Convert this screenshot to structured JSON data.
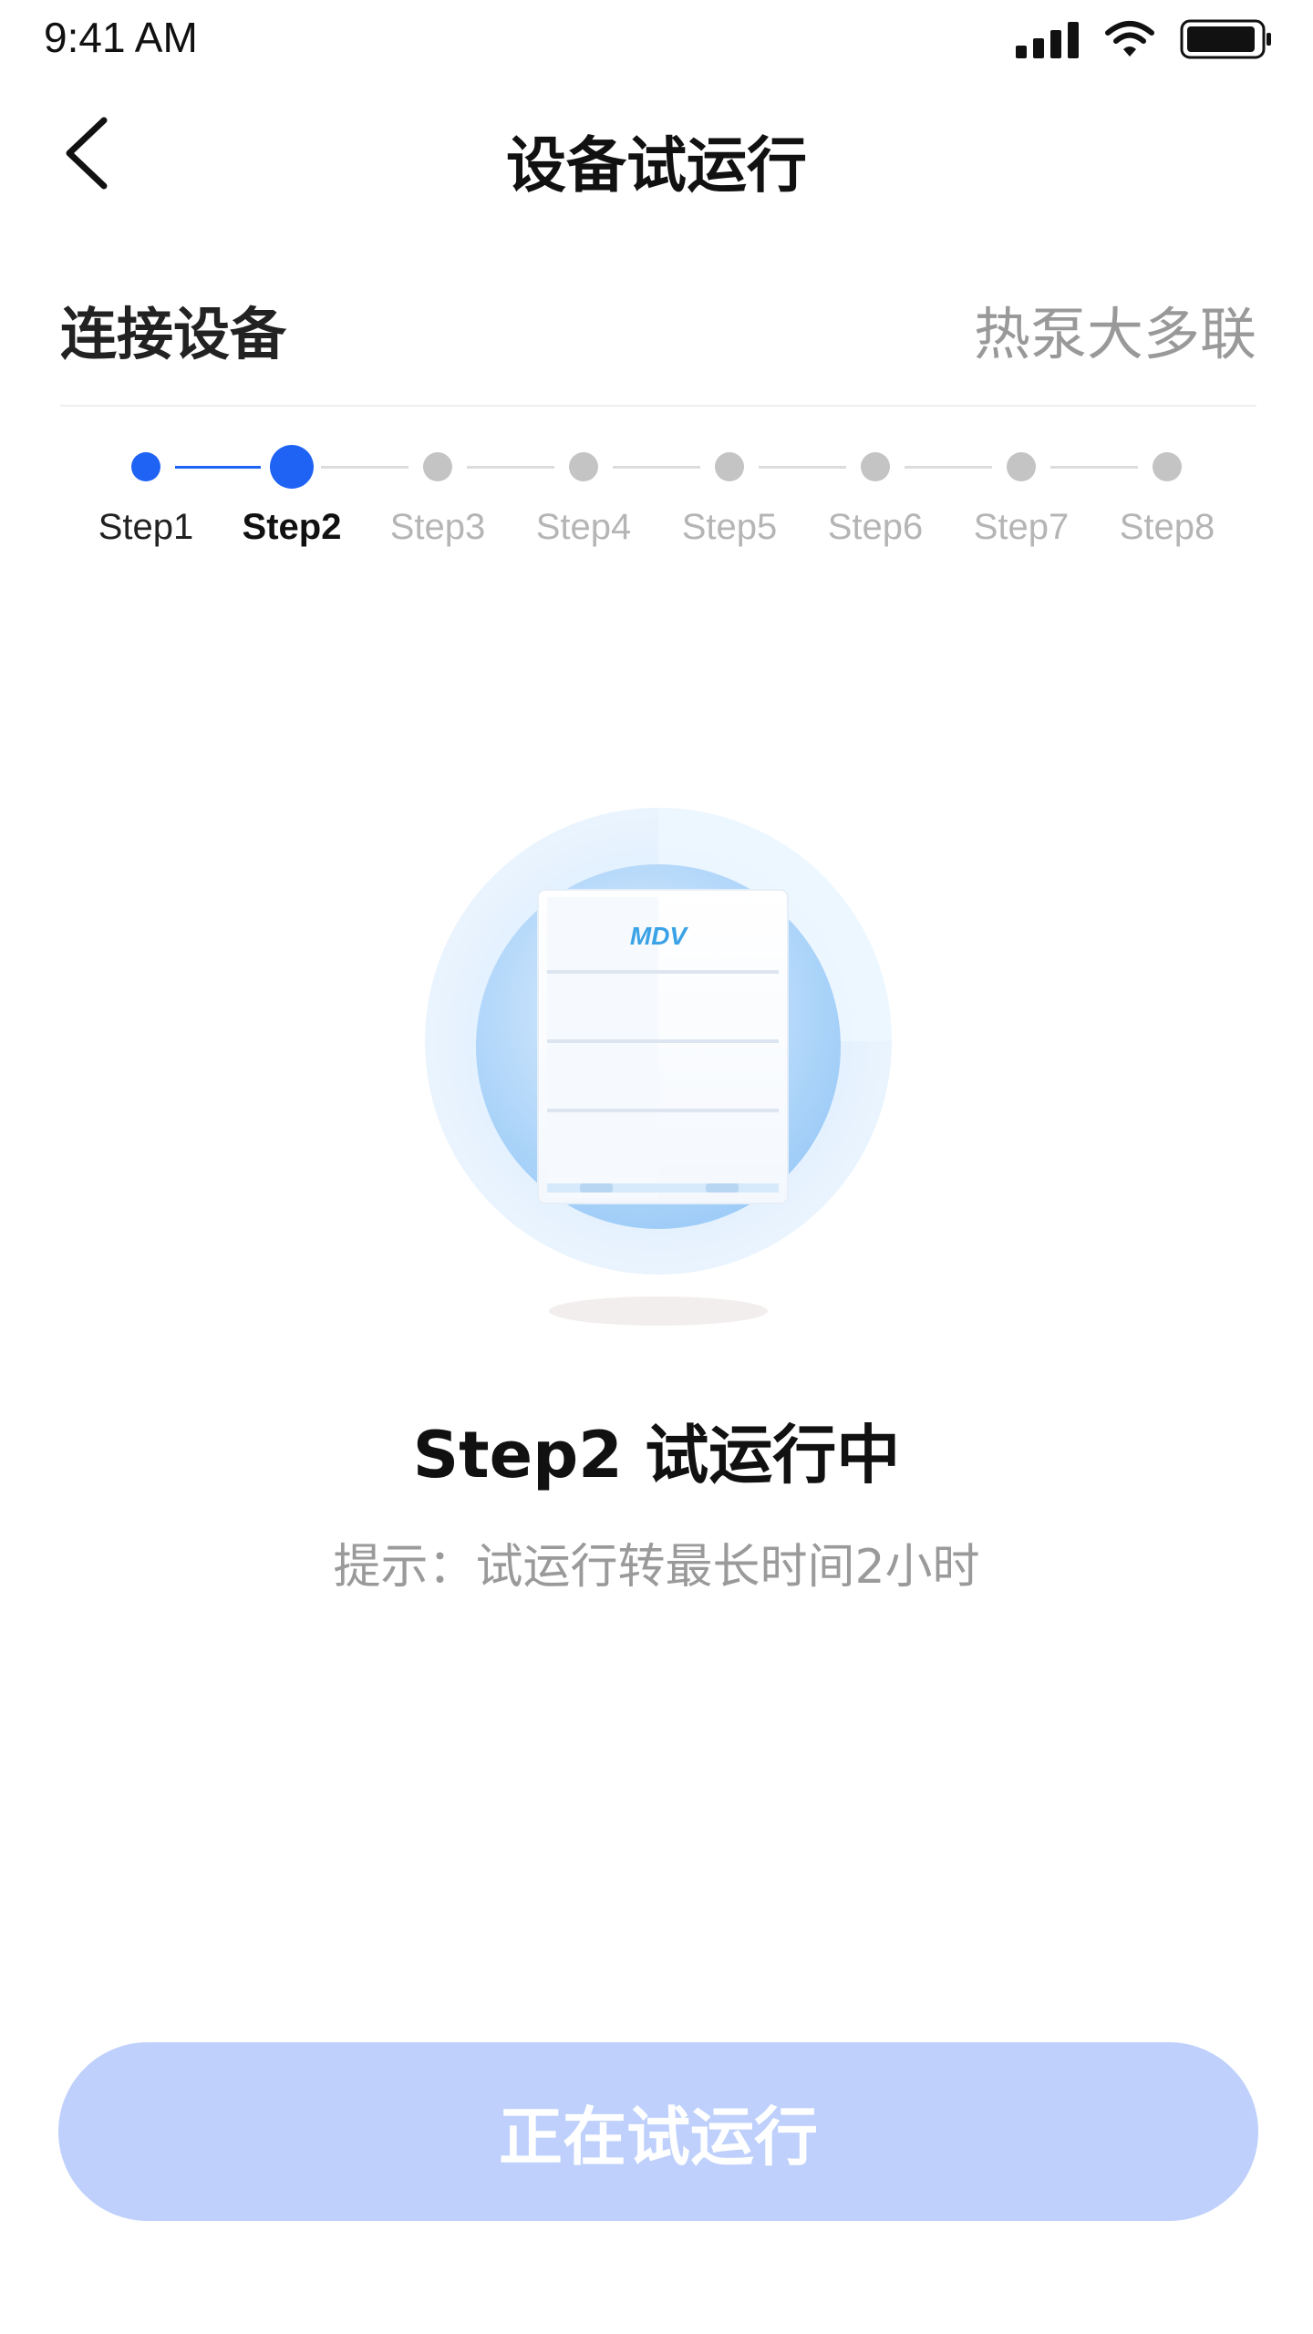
{
  "status_bar": {
    "time": "9:41 AM"
  },
  "header": {
    "title": "设备试运行",
    "back_icon": "chevron-left-icon"
  },
  "section": {
    "title": "连接设备",
    "device_type": "热泵大多联"
  },
  "stepper": {
    "current_index": 1,
    "steps": [
      {
        "label": "Step1",
        "state": "done"
      },
      {
        "label": "Step2",
        "state": "active"
      },
      {
        "label": "Step3",
        "state": "pending"
      },
      {
        "label": "Step4",
        "state": "pending"
      },
      {
        "label": "Step5",
        "state": "pending"
      },
      {
        "label": "Step6",
        "state": "pending"
      },
      {
        "label": "Step7",
        "state": "pending"
      },
      {
        "label": "Step8",
        "state": "pending"
      }
    ]
  },
  "device_logo": "MDV",
  "message": {
    "title": "Step2 试运行中",
    "tip": "提示：试运行转最长时间2小时"
  },
  "action_button": {
    "label": "正在试运行"
  },
  "colors": {
    "accent": "#1f63f5",
    "pending": "#c4c4c4",
    "button_disabled": "#bed0fb"
  }
}
